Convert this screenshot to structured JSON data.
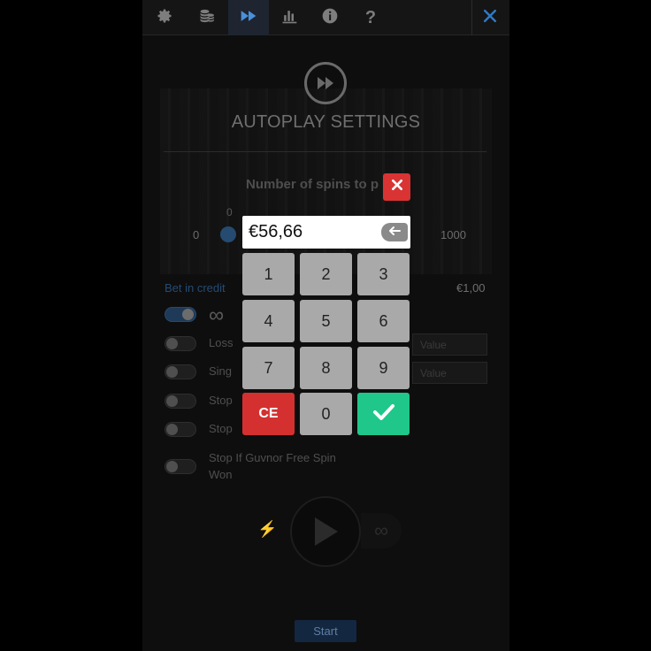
{
  "nav": {
    "items": [
      {
        "icon": "gear-icon"
      },
      {
        "icon": "coins-icon"
      },
      {
        "icon": "fast-forward-icon",
        "active": true
      },
      {
        "icon": "bar-chart-icon"
      },
      {
        "icon": "info-icon"
      },
      {
        "icon": "help-icon",
        "label": "?"
      }
    ],
    "close_icon": "close-icon"
  },
  "autoplay": {
    "title": "AUTOPLAY SETTINGS",
    "spins_label": "Number of spins to p",
    "slider_min": "0",
    "slider_max": "1000",
    "slider_mid_label": "0",
    "bet_label": "Bet in credit",
    "bet_value": "€1,00",
    "infinity_symbol": "∞",
    "options": [
      {
        "label": "Loss",
        "on": false
      },
      {
        "label": "Sing",
        "on": false
      },
      {
        "label": "Stop",
        "on": false
      },
      {
        "label": "Stop",
        "on": false
      },
      {
        "label": "Stop If Guvnor Free Spin Won",
        "on": false
      }
    ],
    "value_placeholder_1": "Value",
    "value_placeholder_2": "Value",
    "start_label": "Start",
    "spin_infinity": "∞"
  },
  "keypad": {
    "display_value": "€56,66",
    "keys": [
      "1",
      "2",
      "3",
      "4",
      "5",
      "6",
      "7",
      "8",
      "9"
    ],
    "clear_label": "CE",
    "zero_label": "0",
    "confirm_icon": "checkmark-icon",
    "backspace_icon": "backspace-arrow-icon",
    "close_icon": "close-icon",
    "colors": {
      "clear": "#d43030",
      "confirm": "#1fc78a",
      "close": "#d93333",
      "key": "#a9a9a9"
    }
  }
}
